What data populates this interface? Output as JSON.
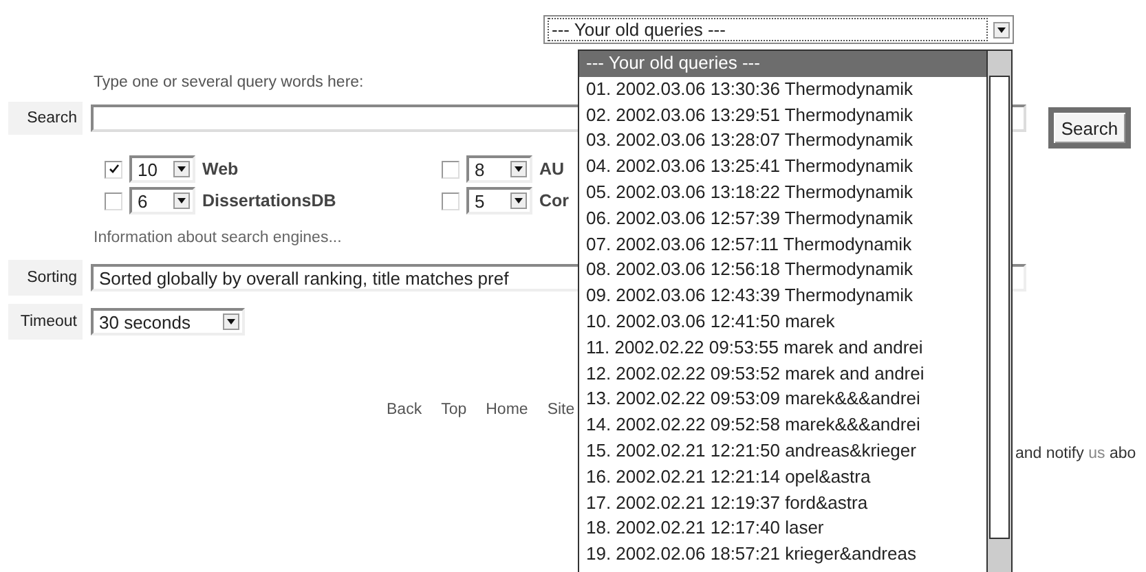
{
  "old_queries": {
    "value": "--- Your old queries ---",
    "options": [
      {
        "label": "--- Your old queries ---",
        "selected": true
      },
      {
        "label": "01. 2002.03.06 13:30:36 Thermodynamik",
        "selected": false
      },
      {
        "label": "02. 2002.03.06 13:29:51 Thermodynamik",
        "selected": false
      },
      {
        "label": "03. 2002.03.06 13:28:07 Thermodynamik",
        "selected": false
      },
      {
        "label": "04. 2002.03.06 13:25:41 Thermodynamik",
        "selected": false
      },
      {
        "label": "05. 2002.03.06 13:18:22 Thermodynamik",
        "selected": false
      },
      {
        "label": "06. 2002.03.06 12:57:39 Thermodynamik",
        "selected": false
      },
      {
        "label": "07. 2002.03.06 12:57:11 Thermodynamik",
        "selected": false
      },
      {
        "label": "08. 2002.03.06 12:56:18 Thermodynamik",
        "selected": false
      },
      {
        "label": "09. 2002.03.06 12:43:39 Thermodynamik",
        "selected": false
      },
      {
        "label": "10. 2002.03.06 12:41:50 marek",
        "selected": false
      },
      {
        "label": "11. 2002.02.22 09:53:55 marek and andrei",
        "selected": false
      },
      {
        "label": "12. 2002.02.22 09:53:52 marek and andrei",
        "selected": false
      },
      {
        "label": "13. 2002.02.22 09:53:09 marek&&&andrei",
        "selected": false
      },
      {
        "label": "14. 2002.02.22 09:52:58 marek&&&andrei",
        "selected": false
      },
      {
        "label": "15. 2002.02.21 12:21:50 andreas&krieger",
        "selected": false
      },
      {
        "label": "16. 2002.02.21 12:21:14 opel&astra",
        "selected": false
      },
      {
        "label": "17. 2002.02.21 12:19:37 ford&astra",
        "selected": false
      },
      {
        "label": "18. 2002.02.21 12:17:40 laser",
        "selected": false
      },
      {
        "label": "19. 2002.02.06 18:57:21 krieger&andreas",
        "selected": false
      }
    ]
  },
  "instruction": "Type one or several query words here:",
  "search": {
    "label": "Search",
    "button": "Search"
  },
  "engines": [
    {
      "checked": true,
      "count": "10",
      "name": "Web"
    },
    {
      "checked": false,
      "count": "8",
      "name": "AU"
    },
    {
      "checked": false,
      "count": "6",
      "name": "DissertationsDB"
    },
    {
      "checked": false,
      "count": "5",
      "name": "Cor"
    }
  ],
  "info_link": "Information about search engines...",
  "sorting": {
    "label": "Sorting",
    "value": "Sorted globally by overall ranking, title matches pref"
  },
  "timeout": {
    "label": "Timeout",
    "value": "30 seconds"
  },
  "footer_links": [
    "Back",
    "Top",
    "Home",
    "Site"
  ],
  "notice": {
    "before": "and notify",
    "link": "us",
    "after": "abo"
  }
}
